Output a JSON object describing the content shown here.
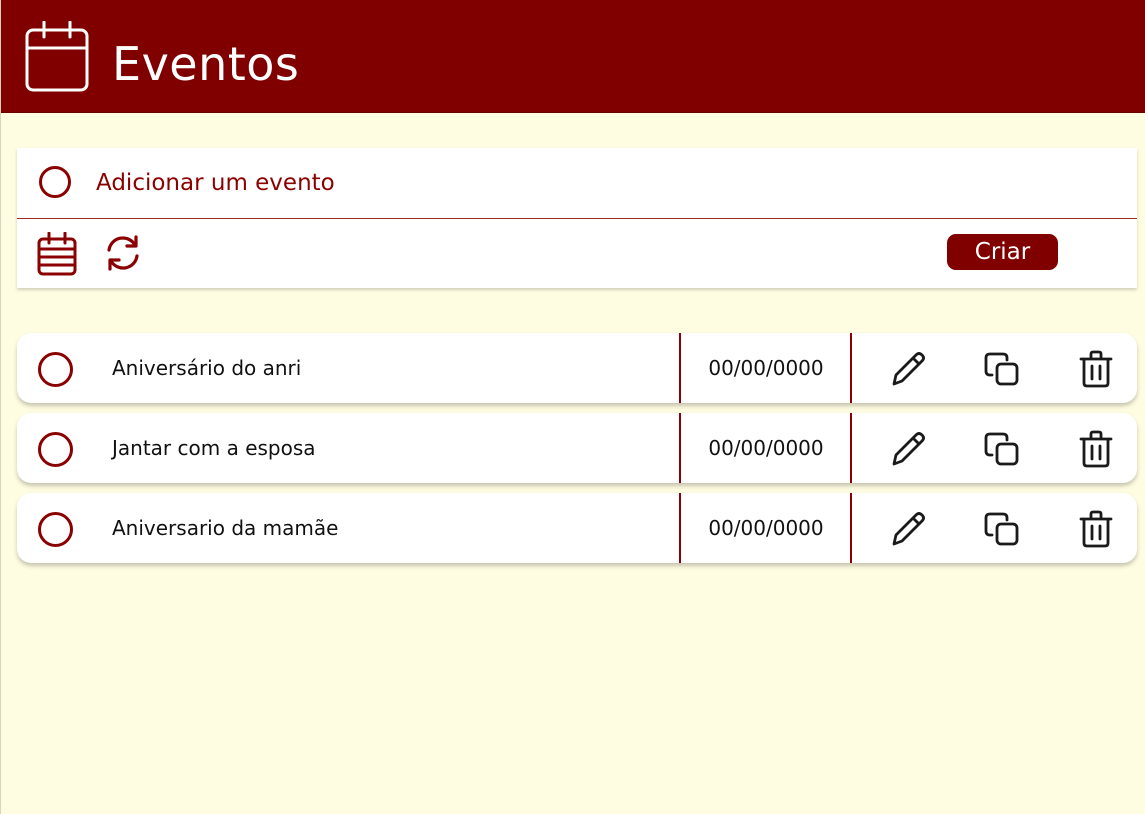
{
  "header": {
    "title": "Eventos",
    "icon": "calendar-icon"
  },
  "add_event": {
    "placeholder": "Adicionar um evento",
    "toolbar": {
      "calendar_icon": "calendar-icon",
      "recurrence_icon": "refresh-icon",
      "create_label": "Criar"
    }
  },
  "events": [
    {
      "title": "Aniversário do anri",
      "date": "00/00/0000"
    },
    {
      "title": "Jantar com a esposa",
      "date": "00/00/0000"
    },
    {
      "title": "Aniversario da mamãe",
      "date": "00/00/0000"
    }
  ],
  "row_actions": [
    "pencil-icon",
    "copy-icon",
    "trash-icon"
  ],
  "colors": {
    "brand": "#800000",
    "background": "#fffde1",
    "card": "#ffffff",
    "text": "#111111"
  }
}
